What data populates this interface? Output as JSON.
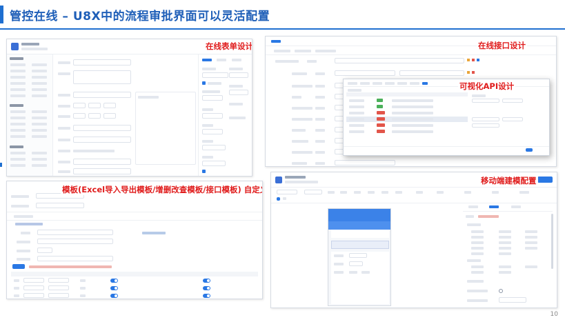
{
  "slide": {
    "title": "管控在线 – U8X中的流程审批界面可以灵活配置",
    "page_number": "10",
    "colors": {
      "title": "#1f5fb8",
      "accent": "#1f6fd0",
      "caption": "#e01c1c"
    }
  },
  "panels": {
    "form_design": {
      "caption": "在线表单设计"
    },
    "interface_design": {
      "caption": "在线接口设计",
      "sub_caption": "可视化API设计"
    },
    "templates": {
      "caption": "模板(Excel导入导出模板/增删改查模板/接口模板) 自定义配置"
    },
    "mobile": {
      "caption": "移动端建模配置"
    }
  }
}
